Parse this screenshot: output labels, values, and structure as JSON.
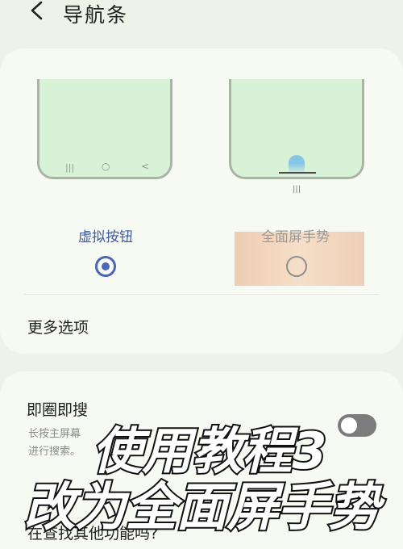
{
  "header": {
    "title": "导航条",
    "back_icon": "chevron-left-icon"
  },
  "nav_options": {
    "left_label": "虚拟按钮",
    "right_label": "全面屏手势",
    "selected": "虚拟按钮",
    "left_keys": [
      "|||",
      "○",
      "<"
    ],
    "right_marker": "|||"
  },
  "more_options": "更多选项",
  "bixby": {
    "title": "即圈即搜",
    "desc_line1": "长按主屏幕",
    "desc_line2": "进行搜索。",
    "toggle_on": false
  },
  "find_more": "在查找其他功能吗?",
  "overlay": {
    "line1": "使用教程3",
    "line2": "改为全面屏手势"
  },
  "colors": {
    "accent": "#4a66b6",
    "phone_screen": "#d8f2d7",
    "highlight": "#f0d2bb"
  }
}
